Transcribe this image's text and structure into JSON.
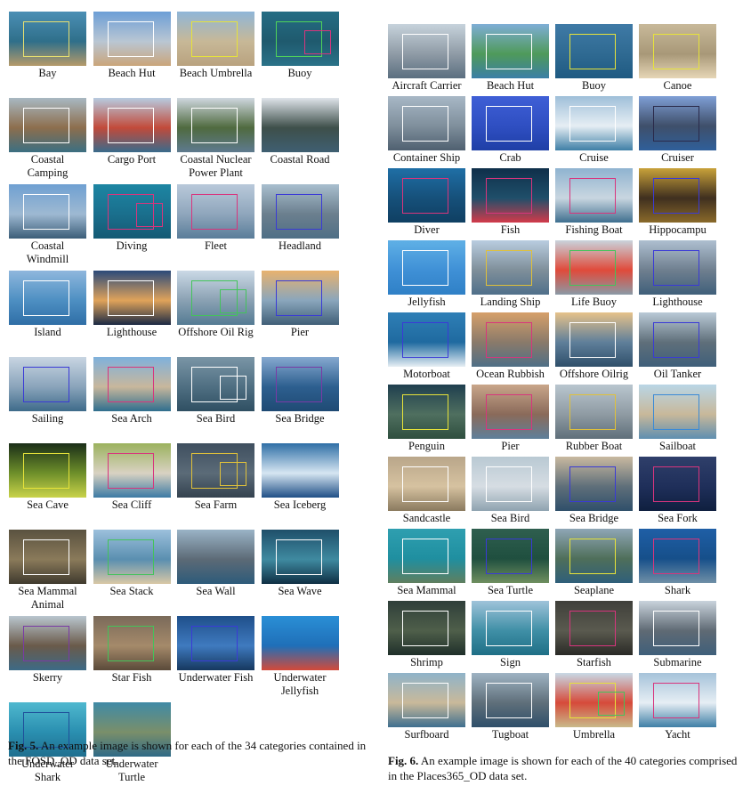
{
  "figures": [
    {
      "caption_label": "Fig. 5.",
      "caption_text": "An example image is shown for each of the 34 categories contained in the FOSD_OD data set.",
      "tiles": [
        {
          "label": "Bay",
          "colors": [
            "#4b8fb5",
            "#2f6f8a",
            "#b59a6a"
          ],
          "boxes": [
            "#e8e070"
          ]
        },
        {
          "label": "Beach Hut",
          "colors": [
            "#6c9ed6",
            "#b9c6d3",
            "#caa57a"
          ],
          "boxes": [
            "#ffffff"
          ]
        },
        {
          "label": "Beach Umbrella",
          "colors": [
            "#8fb6d8",
            "#c7b897",
            "#b9a27f"
          ],
          "boxes": [
            "#e7e33a"
          ]
        },
        {
          "label": "Buoy",
          "colors": [
            "#256d84",
            "#1f5a6e",
            "#2a7288"
          ],
          "boxes": [
            "#4fd35a",
            "#d8357d"
          ]
        },
        {
          "label": "Coastal\nCamping",
          "colors": [
            "#a8b8c2",
            "#8d6e4d",
            "#3b6f82"
          ],
          "boxes": [
            "#ffffff"
          ]
        },
        {
          "label": "Cargo Port",
          "colors": [
            "#b7cbe0",
            "#c24a3a",
            "#3a6b8c"
          ],
          "boxes": [
            "#ffffff"
          ]
        },
        {
          "label": "Coastal Nuclear\nPower Plant",
          "colors": [
            "#cfd7df",
            "#4f6a3f",
            "#5e7a8f"
          ],
          "boxes": [
            "#ffffff"
          ]
        },
        {
          "label": "Coastal Road",
          "colors": [
            "#dfe4ea",
            "#3e4f4a",
            "#3f5f72"
          ],
          "boxes": []
        },
        {
          "label": "Coastal\nWindmill",
          "colors": [
            "#6fa0d2",
            "#9eb9d2",
            "#3b5d78"
          ],
          "boxes": [
            "#ffffff"
          ]
        },
        {
          "label": "Diving",
          "colors": [
            "#1d86a3",
            "#1a6f8d",
            "#145a74"
          ],
          "boxes": [
            "#d8357d",
            "#d8357d"
          ]
        },
        {
          "label": "Fleet",
          "colors": [
            "#b9c9da",
            "#8fa6bc",
            "#5a7d99"
          ],
          "boxes": [
            "#d8357d"
          ]
        },
        {
          "label": "Headland",
          "colors": [
            "#a9bfcf",
            "#6b7f8e",
            "#4f6f86"
          ],
          "boxes": [
            "#3a3ad6"
          ]
        },
        {
          "label": "Island",
          "colors": [
            "#8fb7dd",
            "#4d8fc2",
            "#2f6ea6"
          ],
          "boxes": [
            "#ffffff"
          ]
        },
        {
          "label": "Lighthouse",
          "colors": [
            "#2a4a7a",
            "#e0a35a",
            "#1b2a44"
          ],
          "boxes": [
            "#ffffff"
          ]
        },
        {
          "label": "Offshore Oil Rig",
          "colors": [
            "#cbd9e6",
            "#8aa1b3",
            "#547b93"
          ],
          "boxes": [
            "#43c35a",
            "#43c35a"
          ]
        },
        {
          "label": "Pier",
          "colors": [
            "#e8b26e",
            "#8aa6bc",
            "#405f77"
          ],
          "boxes": [
            "#3a3ad6"
          ]
        },
        {
          "label": "Sailing",
          "colors": [
            "#c8d5e2",
            "#8aa4bb",
            "#3e6b8a"
          ],
          "boxes": [
            "#3a3ad6"
          ]
        },
        {
          "label": "Sea Arch",
          "colors": [
            "#7fb1dc",
            "#c8b79c",
            "#2f6e8e"
          ],
          "boxes": [
            "#d8357d"
          ]
        },
        {
          "label": "Sea Bird",
          "colors": [
            "#7a95a6",
            "#4f6f82",
            "#2f4f62"
          ],
          "boxes": [
            "#ffffff",
            "#ffffff"
          ]
        },
        {
          "label": "Sea Bridge",
          "colors": [
            "#86a9d0",
            "#2d5f8f",
            "#1f4a74"
          ],
          "boxes": [
            "#7a3aa6"
          ]
        },
        {
          "label": "Sea Cave",
          "colors": [
            "#1a2e18",
            "#6e8f2a",
            "#c9d34a"
          ],
          "boxes": [
            "#e7e33a"
          ]
        },
        {
          "label": "Sea Cliff",
          "colors": [
            "#9bb25e",
            "#d9d2c2",
            "#3c7aa4"
          ],
          "boxes": [
            "#d8357d"
          ]
        },
        {
          "label": "Sea Farm",
          "colors": [
            "#3f4f5f",
            "#5b6b78",
            "#34424f"
          ],
          "boxes": [
            "#e0c13a",
            "#e0c13a"
          ]
        },
        {
          "label": "Sea Iceberg",
          "colors": [
            "#2f6fa6",
            "#d6e6f2",
            "#1f4f86"
          ],
          "boxes": []
        },
        {
          "label": "Sea Mammal\nAnimal",
          "colors": [
            "#5a5240",
            "#8a7a5a",
            "#3f3a2e"
          ],
          "boxes": [
            "#ffffff"
          ]
        },
        {
          "label": "Sea Stack",
          "colors": [
            "#9cc0dc",
            "#5a8fb0",
            "#d9c8a6"
          ],
          "boxes": [
            "#43c35a"
          ]
        },
        {
          "label": "Sea Wall",
          "colors": [
            "#9ab3c6",
            "#5c6a76",
            "#2d5b7a"
          ],
          "boxes": []
        },
        {
          "label": "Sea Wave",
          "colors": [
            "#1f4f6a",
            "#3f8aa0",
            "#0f2f44"
          ],
          "boxes": [
            "#ffffff"
          ]
        },
        {
          "label": "Skerry",
          "colors": [
            "#b9c6cf",
            "#6a5a4a",
            "#3d6a86"
          ],
          "boxes": [
            "#7a3aa6"
          ]
        },
        {
          "label": "Star Fish",
          "colors": [
            "#7a6a5a",
            "#a58a6a",
            "#5a4a3a"
          ],
          "boxes": [
            "#43c35a"
          ]
        },
        {
          "label": "Underwater Fish",
          "colors": [
            "#1f4f8a",
            "#3f7abf",
            "#16385f"
          ],
          "boxes": [
            "#3a3ad6"
          ]
        },
        {
          "label": "Underwater\nJellyfish",
          "colors": [
            "#2a8fd6",
            "#1f6fb8",
            "#d34a3a"
          ],
          "boxes": []
        },
        {
          "label": "Underwater\nShark",
          "colors": [
            "#4fb8cf",
            "#2a8fb0",
            "#1f6f8f"
          ],
          "boxes": [
            "#1f4f9a"
          ]
        },
        {
          "label": "Underwater\nTurtle",
          "colors": [
            "#3f8aa6",
            "#7a8f6a",
            "#2f6a86"
          ],
          "boxes": []
        }
      ]
    },
    {
      "caption_label": "Fig. 6.",
      "caption_text": "An example image is shown for each of the 40 categories comprised in the Places365_OD data set.",
      "tiles": [
        {
          "label": "Aircraft Carrier",
          "colors": [
            "#c7d3dc",
            "#8f9ba6",
            "#5b6f80"
          ],
          "boxes": [
            "#ffffff"
          ]
        },
        {
          "label": "Beach Hut",
          "colors": [
            "#7faed6",
            "#4f9a5a",
            "#3b7fa6"
          ],
          "boxes": [
            "#ffffff"
          ]
        },
        {
          "label": "Buoy",
          "colors": [
            "#3f7aa6",
            "#2f6a92",
            "#1f5a82"
          ],
          "boxes": [
            "#e7e33a"
          ]
        },
        {
          "label": "Canoe",
          "colors": [
            "#c8b99a",
            "#a89878",
            "#e6d6b6"
          ],
          "boxes": [
            "#e7e33a"
          ]
        },
        {
          "label": "Container Ship",
          "colors": [
            "#a8b8c6",
            "#7f8f9c",
            "#4f6070"
          ],
          "boxes": [
            "#ffffff"
          ]
        },
        {
          "label": "Crab",
          "colors": [
            "#3f5fd6",
            "#2f4fc2",
            "#1f3fa6"
          ],
          "boxes": [
            "#ffffff"
          ]
        },
        {
          "label": "Cruise",
          "colors": [
            "#9fbfd9",
            "#e6eef4",
            "#3f7fa6"
          ],
          "boxes": [
            "#ffffff"
          ]
        },
        {
          "label": "Cruiser",
          "colors": [
            "#7f9fd6",
            "#3f4f6a",
            "#2f5f9a"
          ],
          "boxes": [
            "#2a2a4a"
          ]
        },
        {
          "label": "Diver",
          "colors": [
            "#1f6fa6",
            "#16507a",
            "#0f3f62"
          ],
          "boxes": [
            "#d8357d"
          ]
        },
        {
          "label": "Fish",
          "colors": [
            "#0f2f4a",
            "#1f4f6a",
            "#d33a4a"
          ],
          "boxes": [
            "#d8357d"
          ]
        },
        {
          "label": "Fishing Boat",
          "colors": [
            "#8fb3d0",
            "#c9d6e0",
            "#3f6f8f"
          ],
          "boxes": [
            "#d8357d"
          ]
        },
        {
          "label": "Hippocampu",
          "colors": [
            "#c9a23a",
            "#3f2f1f",
            "#8a6a2a"
          ],
          "boxes": [
            "#3a3ad6"
          ]
        },
        {
          "label": "Jellyfish",
          "colors": [
            "#5fb0e6",
            "#3f90d6",
            "#2f80c6"
          ],
          "boxes": [
            "#ffffff"
          ]
        },
        {
          "label": "Landing Ship",
          "colors": [
            "#b9cde0",
            "#7f8f9a",
            "#4f6f8a"
          ],
          "boxes": [
            "#e0c13a"
          ]
        },
        {
          "label": "Life Buoy",
          "colors": [
            "#c9d3dc",
            "#e04a3a",
            "#8a9aa6"
          ],
          "boxes": [
            "#43c35a"
          ]
        },
        {
          "label": "Lighthouse",
          "colors": [
            "#aebfd0",
            "#6f7f8f",
            "#3f5f7a"
          ],
          "boxes": [
            "#3a3ad6"
          ]
        },
        {
          "label": "Motorboat",
          "colors": [
            "#2f7fb6",
            "#1f6aa0",
            "#e6eef4"
          ],
          "boxes": [
            "#3a3ad6"
          ]
        },
        {
          "label": "Ocean Rubbish",
          "colors": [
            "#d6a06a",
            "#8a7a6a",
            "#4f6f86"
          ],
          "boxes": [
            "#d8357d"
          ]
        },
        {
          "label": "Offshore Oilrig",
          "colors": [
            "#e6c28a",
            "#5f7f9a",
            "#2f4f6a"
          ],
          "boxes": [
            "#ffffff"
          ]
        },
        {
          "label": "Oil Tanker",
          "colors": [
            "#b9c9d6",
            "#5f6f7a",
            "#3f5f7a"
          ],
          "boxes": [
            "#3a3ad6"
          ]
        },
        {
          "label": "Penguin",
          "colors": [
            "#1f3f4f",
            "#4f6f5f",
            "#2f4f3f"
          ],
          "boxes": [
            "#e7e33a"
          ]
        },
        {
          "label": "Pier",
          "colors": [
            "#c9a68a",
            "#8a6a5a",
            "#5f7f9a"
          ],
          "boxes": [
            "#d8357d"
          ]
        },
        {
          "label": "Rubber Boat",
          "colors": [
            "#b9c6cf",
            "#8f9ba3",
            "#5f6f7a"
          ],
          "boxes": [
            "#e0c13a"
          ]
        },
        {
          "label": "Sailboat",
          "colors": [
            "#b9d6e6",
            "#c8b89a",
            "#5f8fb0"
          ],
          "boxes": [
            "#3a8ad6"
          ]
        },
        {
          "label": "Sandcastle",
          "colors": [
            "#b9a68a",
            "#d6c2a0",
            "#8a7a5f"
          ],
          "boxes": [
            "#ffffff"
          ]
        },
        {
          "label": "Sea Bird",
          "colors": [
            "#b9c9d3",
            "#d6dde3",
            "#8fa3b0"
          ],
          "boxes": [
            "#ffffff"
          ]
        },
        {
          "label": "Sea Bridge",
          "colors": [
            "#c9b9a0",
            "#5f6f7a",
            "#2f4f6a"
          ],
          "boxes": [
            "#3a3ad6"
          ]
        },
        {
          "label": "Sea Fork",
          "colors": [
            "#2f3f6a",
            "#1f2f5a",
            "#0f1f3f"
          ],
          "boxes": [
            "#d8357d"
          ]
        },
        {
          "label": "Sea Mammal",
          "colors": [
            "#2f9fb0",
            "#1f8fa0",
            "#5f7f5f"
          ],
          "boxes": [
            "#ffffff"
          ]
        },
        {
          "label": "Sea Turtle",
          "colors": [
            "#2f5f4f",
            "#1f4f3f",
            "#6f8f5f"
          ],
          "boxes": [
            "#3a3ad6"
          ]
        },
        {
          "label": "Seaplane",
          "colors": [
            "#8fa6b6",
            "#4f6f5a",
            "#2f5f7a"
          ],
          "boxes": [
            "#e7e33a"
          ]
        },
        {
          "label": "Shark",
          "colors": [
            "#1f5fa6",
            "#164f8a",
            "#6f8fa6"
          ],
          "boxes": [
            "#d8357d"
          ]
        },
        {
          "label": "Shrimp",
          "colors": [
            "#2f3f3a",
            "#4f5f4a",
            "#1f2f2a"
          ],
          "boxes": [
            "#ffffff"
          ]
        },
        {
          "label": "Sign",
          "colors": [
            "#9fc3da",
            "#3f8fa6",
            "#1f6f86"
          ],
          "boxes": [
            "#ffffff"
          ]
        },
        {
          "label": "Starfish",
          "colors": [
            "#3f3f3a",
            "#5a5a4f",
            "#2a2a26"
          ],
          "boxes": [
            "#d8357d"
          ]
        },
        {
          "label": "Submarine",
          "colors": [
            "#c9d3dc",
            "#5f6a74",
            "#3f5f7a"
          ],
          "boxes": [
            "#ffffff"
          ]
        },
        {
          "label": "Surfboard",
          "colors": [
            "#8fb3c9",
            "#c9b99a",
            "#3f6f8f"
          ],
          "boxes": [
            "#ffffff"
          ]
        },
        {
          "label": "Tugboat",
          "colors": [
            "#9fb3c3",
            "#5f6f7a",
            "#2f4f6a"
          ],
          "boxes": [
            "#ffffff"
          ]
        },
        {
          "label": "Umbrella",
          "colors": [
            "#c8d9e6",
            "#d64a3a",
            "#c9b98a"
          ],
          "boxes": [
            "#e7e33a",
            "#43c35a"
          ]
        },
        {
          "label": "Yacht",
          "colors": [
            "#a6c3da",
            "#e6eef4",
            "#3f7fa6"
          ],
          "boxes": [
            "#d8357d"
          ]
        }
      ]
    }
  ]
}
